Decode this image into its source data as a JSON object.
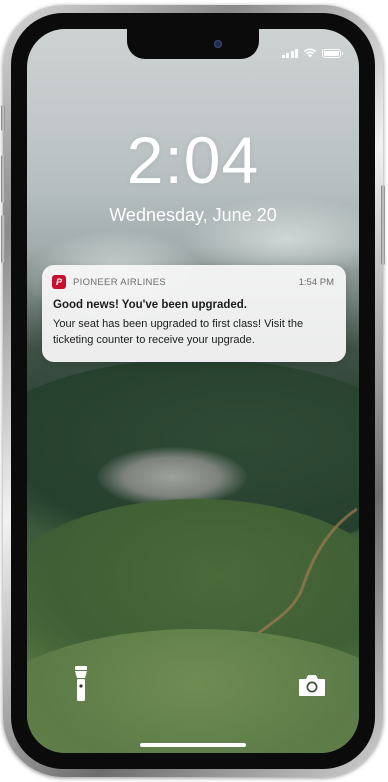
{
  "lockscreen": {
    "time": "2:04",
    "date": "Wednesday, June 20"
  },
  "notification": {
    "app_icon_letter": "P",
    "app_name": "PIONEER AIRLINES",
    "time": "1:54 PM",
    "title": "Good news! You've been upgraded.",
    "body": "Your seat has been upgraded to first class! Visit the ticketing counter to receive your upgrade.",
    "brand_color": "#c8102e"
  },
  "status_bar": {
    "icons": [
      "cellular-signal-icon",
      "wifi-icon",
      "battery-icon"
    ]
  },
  "quick_actions": {
    "left": "flashlight-icon",
    "right": "camera-icon"
  }
}
